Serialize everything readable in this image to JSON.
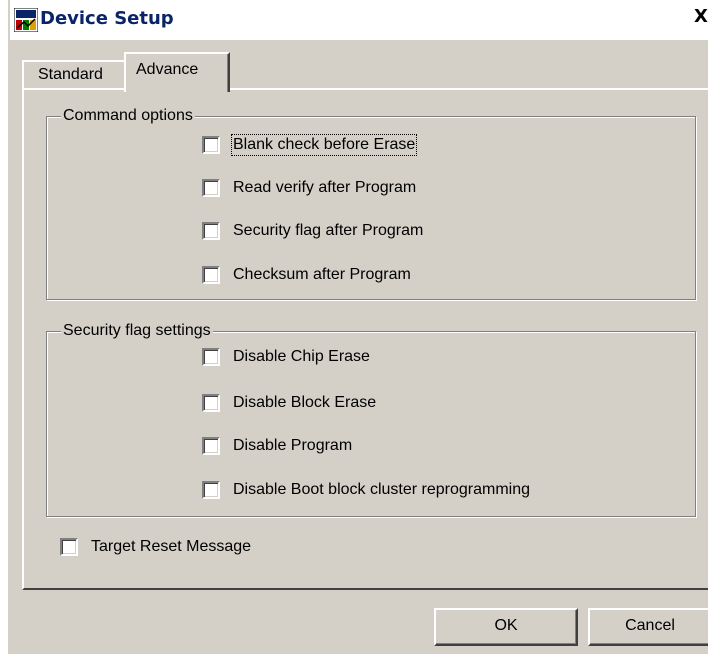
{
  "window": {
    "title": "Device Setup",
    "close_glyph": "X",
    "icon": "device-setup-app-icon"
  },
  "tabs": [
    {
      "label": "Standard",
      "selected": false
    },
    {
      "label": "Advance",
      "selected": true
    }
  ],
  "command_options": {
    "legend": "Command options",
    "items": [
      {
        "label": "Blank check before Erase",
        "checked": false,
        "focused": true
      },
      {
        "label": "Read verify after Program",
        "checked": false
      },
      {
        "label": "Security flag after Program",
        "checked": false
      },
      {
        "label": "Checksum after Program",
        "checked": false
      }
    ]
  },
  "security_flag_settings": {
    "legend": "Security flag settings",
    "items": [
      {
        "label": "Disable Chip Erase",
        "checked": false
      },
      {
        "label": "Disable Block Erase",
        "checked": false
      },
      {
        "label": "Disable Program",
        "checked": false
      },
      {
        "label": "Disable Boot block cluster reprogramming",
        "checked": false
      }
    ]
  },
  "target_reset": {
    "label": "Target Reset Message",
    "checked": false
  },
  "buttons": {
    "ok": "OK",
    "cancel": "Cancel"
  },
  "colors": {
    "face": "#d4d0c8",
    "title_text": "#0a246a",
    "highlight": "#ffffff",
    "shadow": "#808080"
  }
}
